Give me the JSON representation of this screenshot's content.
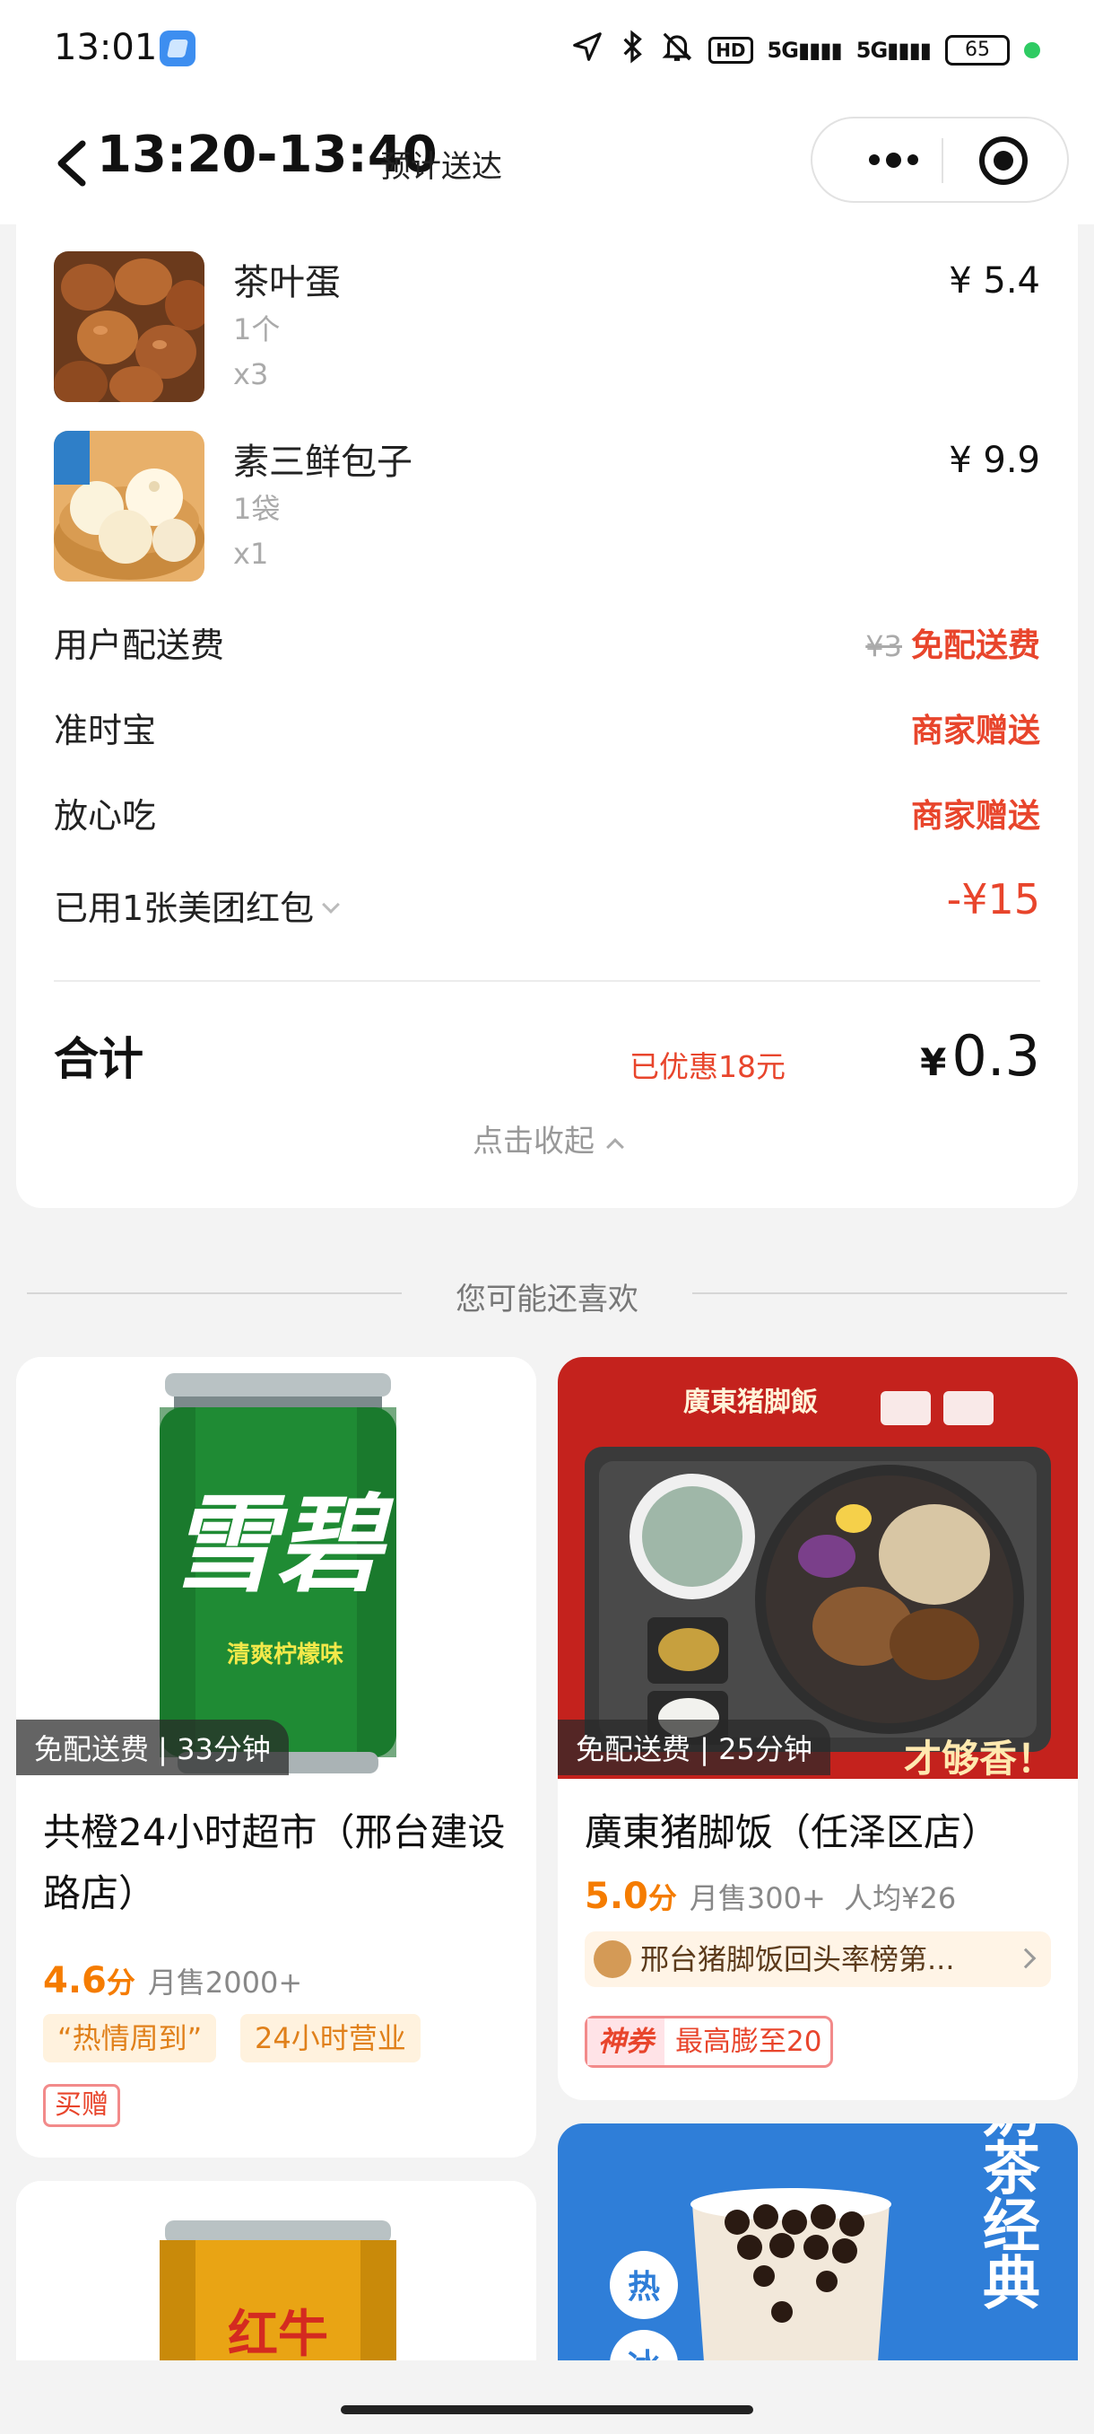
{
  "status_bar": {
    "time": "13:01",
    "icons": [
      "location-arrow-icon",
      "bluetooth-icon",
      "mute-bell-icon",
      "hd-icon",
      "signal-5g-icon",
      "signal-5g-icon"
    ],
    "hd_label": "HD",
    "network_1": "5G",
    "network_2": "5G",
    "battery": "65"
  },
  "nav": {
    "title": "13:20-13:40",
    "subtitle": "预计送达"
  },
  "order": {
    "items": [
      {
        "name": "茶叶蛋",
        "spec": "1个",
        "qty": "x3",
        "price": "¥ 5.4"
      },
      {
        "name": "素三鲜包子",
        "spec": "1袋",
        "qty": "x1",
        "price": "¥ 9.9"
      }
    ],
    "fees": {
      "delivery_label": "用户配送费",
      "delivery_old": "¥3",
      "delivery_value": "免配送费",
      "ontime_label": "准时宝",
      "ontime_value": "商家赠送",
      "safe_label": "放心吃",
      "safe_value": "商家赠送",
      "redpack_label": "已用1张美团红包",
      "redpack_value": "-¥15"
    },
    "total_label": "合计",
    "discount": "已优惠18元",
    "total_currency": "¥",
    "total_amount": "0.3",
    "collapse_label": "点击收起"
  },
  "recommend": {
    "title": "您可能还喜欢",
    "stores": [
      {
        "badge": "免配送费 | 33分钟",
        "name": "共橙24小时超市（邢台建设路店）",
        "score": "4.6",
        "score_unit": "分",
        "sales": "月售2000+",
        "tags": [
          "“热情周到”",
          "24小时营业"
        ],
        "promo": "买赠",
        "image_text": "雪碧",
        "image_subtext": "清爽柠檬味"
      },
      {
        "badge": "免配送费 | 25分钟",
        "name": "廣東猪脚饭（任泽区店）",
        "score": "5.0",
        "score_unit": "分",
        "sales": "月售300+",
        "avg_price": "人均¥26",
        "rank": "邢台猪脚饭回头率榜第...",
        "coupon_tag": "神券",
        "coupon_text": "最高膨至20",
        "image_text": "廣東猪脚飯",
        "image_slogan": "才够香！"
      },
      {
        "image_text": "红牛"
      },
      {
        "image_text": "奶茶经典",
        "image_hot": "热",
        "image_cold": "冰"
      }
    ]
  },
  "colors": {
    "accent_red": "#e8452c",
    "score_orange": "#f57c00",
    "background": "#f3f3f3"
  }
}
